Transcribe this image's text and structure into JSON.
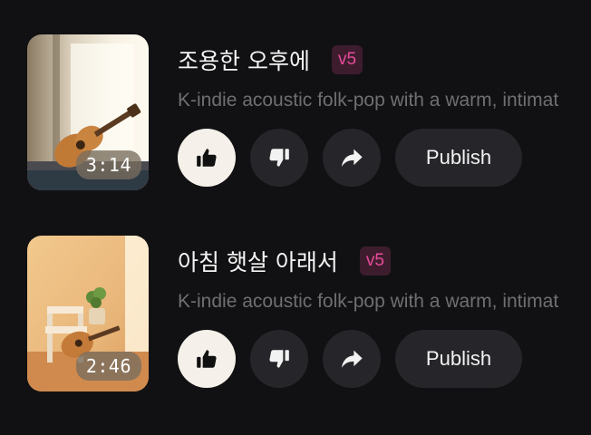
{
  "tracks": [
    {
      "title": "조용한 오후에",
      "version": "v5",
      "description": "K-indie acoustic folk-pop with a warm, intimat",
      "duration": "3:14",
      "liked": true,
      "publish_label": "Publish"
    },
    {
      "title": "아침 햇살 아래서",
      "version": "v5",
      "description": "K-indie acoustic folk-pop with a warm, intimat",
      "duration": "2:46",
      "liked": true,
      "publish_label": "Publish"
    }
  ],
  "colors": {
    "background": "#111113",
    "version_badge_bg": "#3d1d2d",
    "version_badge_text": "#e84a9a",
    "button_bg": "#26262a",
    "liked_button_bg": "#f5f1ea"
  }
}
